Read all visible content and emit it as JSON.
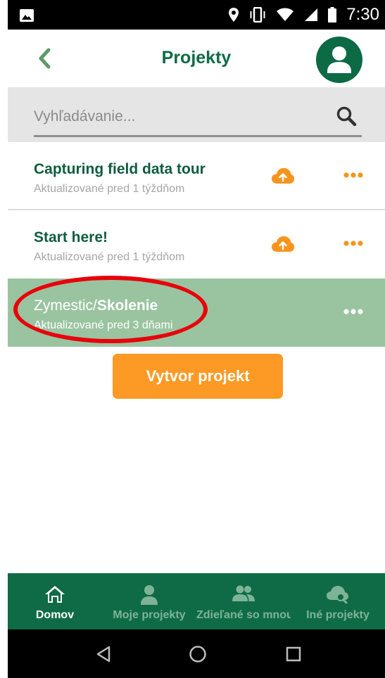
{
  "status_bar": {
    "time": "7:30",
    "icons": [
      "image-icon",
      "location-icon",
      "vibrate-icon",
      "wifi-icon",
      "signal-icon",
      "battery-icon"
    ]
  },
  "header": {
    "title": "Projekty",
    "back_icon": "chevron-left-icon",
    "avatar_icon": "user-icon"
  },
  "search": {
    "placeholder": "Vyhľadávanie...",
    "icon": "search-icon"
  },
  "projects": [
    {
      "title": "Capturing field data tour",
      "subtitle": "Aktualizované pred 1 týždňom",
      "upload_icon": "cloud-upload-icon",
      "more_icon": "more-icon"
    },
    {
      "title": "Start here!",
      "subtitle": "Aktualizované pred 1 týždňom",
      "upload_icon": "cloud-upload-icon",
      "more_icon": "more-icon"
    },
    {
      "title_prefix": "Zymestic/",
      "title_bold": "Skolenie",
      "subtitle": "Aktualizované pred 3 dňami",
      "more_icon": "more-icon",
      "selected": true
    }
  ],
  "create_button": {
    "label": "Vytvor projekt"
  },
  "bottom_nav": [
    {
      "label": "Domov",
      "icon": "home-icon",
      "active": true
    },
    {
      "label": "Moje projekty",
      "icon": "person-icon"
    },
    {
      "label": "Zdieľané so mnou",
      "icon": "people-icon"
    },
    {
      "label": "Iné projekty",
      "icon": "cloud-search-icon"
    }
  ],
  "system_nav": [
    "back-icon",
    "home-circle-icon",
    "recents-icon"
  ],
  "colors": {
    "brand_green": "#0e6b46",
    "selected_row": "#9ac4a0",
    "accent_orange": "#fc9a25",
    "annotation_red": "#e8000b"
  }
}
